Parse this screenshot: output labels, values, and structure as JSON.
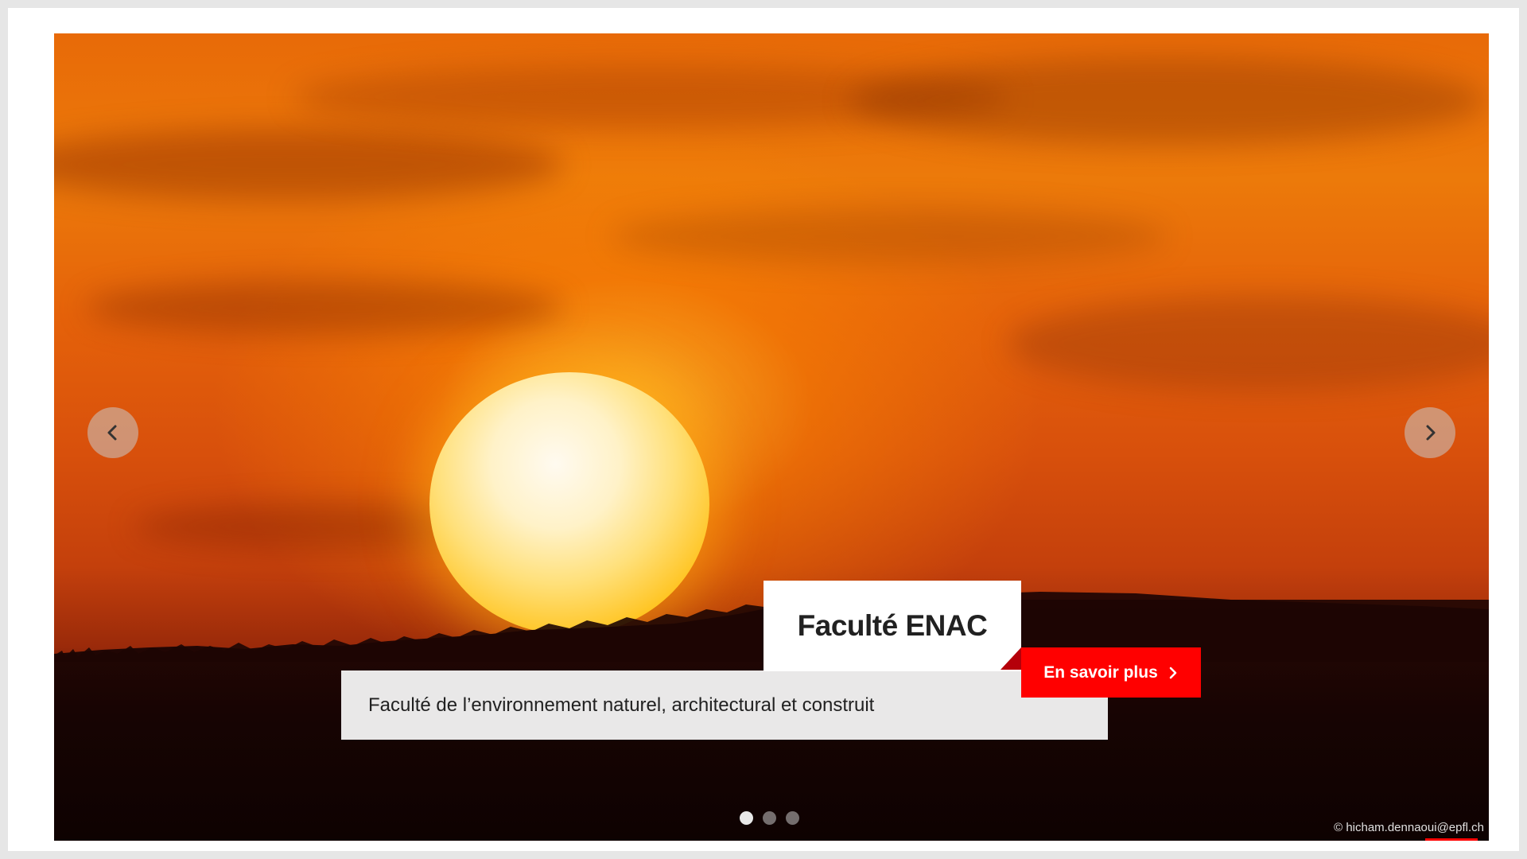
{
  "slider": {
    "title": "Faculté ENAC",
    "description": "Faculté de l’environnement naturel, architectural et construit",
    "cta_label": "En savoir plus",
    "cta_icon": "chevron-right-icon",
    "prev_icon": "chevron-left-icon",
    "next_icon": "chevron-right-icon",
    "credit": "© hicham.dennaoui@epfl.ch",
    "slide_count": 3,
    "active_slide": 1
  },
  "colors": {
    "accent": "#ff0000",
    "title_bg": "#ffffff",
    "description_bg": "#e9e8e8"
  }
}
